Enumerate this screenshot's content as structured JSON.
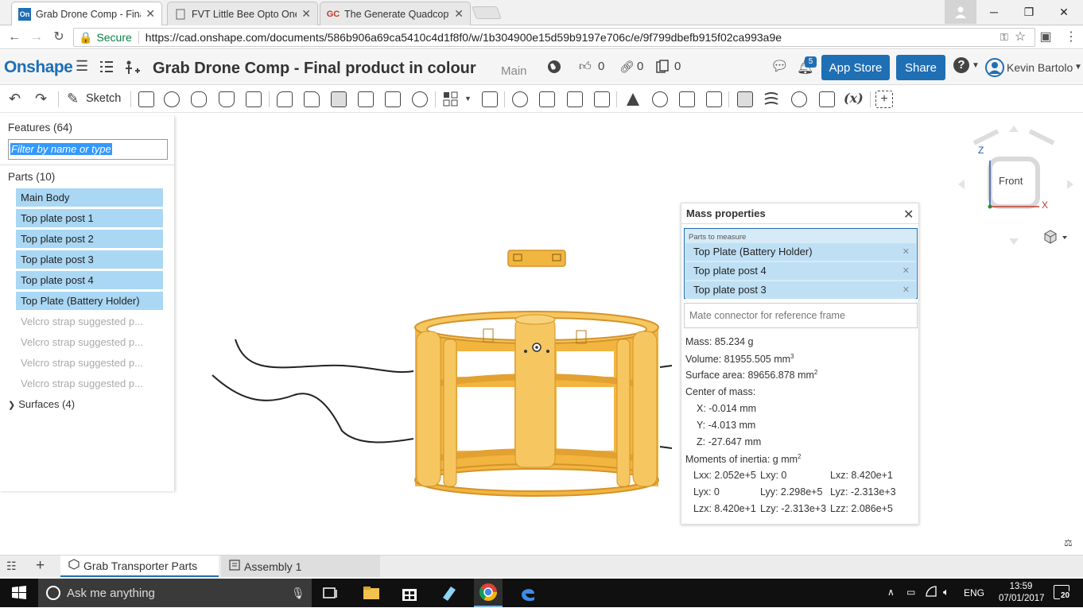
{
  "browser": {
    "tabs": [
      {
        "title": "Grab Drone Comp - Fina",
        "favicon": "On",
        "active": true
      },
      {
        "title": "FVT Little Bee Opto One",
        "favicon": "doc",
        "active": false
      },
      {
        "title": "The Generate Quadcopte",
        "favicon": "GC",
        "active": false
      }
    ],
    "secure_label": "Secure",
    "url": "https://cad.onshape.com/documents/586b906a69ca5410c4d1f8f0/w/1b304900e15d59b9197e706c/e/9f799dbefb915f02ca993a9e"
  },
  "header": {
    "logo": "Onshape",
    "doc_title": "Grab Drone Comp - Final product in colour",
    "branch": "Main",
    "likes": "0",
    "links": "0",
    "copies": "0",
    "notifications": "5",
    "app_store_label": "App Store",
    "share_label": "Share",
    "help_label": "?",
    "user": "Kevin Bartolo"
  },
  "toolbar": {
    "sketch_label": "Sketch",
    "variable_label": "(x)"
  },
  "features": {
    "title": "Features (64)",
    "filter_placeholder": "Filter by name or type",
    "parts_title": "Parts (10)",
    "parts": [
      {
        "name": "Main Body",
        "selected": true
      },
      {
        "name": "Top plate post 1",
        "selected": true
      },
      {
        "name": "Top plate post 2",
        "selected": true
      },
      {
        "name": "Top plate post 3",
        "selected": true
      },
      {
        "name": "Top plate post 4",
        "selected": true
      },
      {
        "name": "Top Plate (Battery Holder)",
        "selected": true
      },
      {
        "name": "Velcro strap suggested p...",
        "selected": false
      },
      {
        "name": "Velcro strap suggested p...",
        "selected": false
      },
      {
        "name": "Velcro strap suggested p...",
        "selected": false
      },
      {
        "name": "Velcro strap suggested p...",
        "selected": false
      }
    ],
    "surfaces": "Surfaces (4)"
  },
  "mass_properties": {
    "title": "Mass properties",
    "parts_label": "Parts to measure",
    "parts": [
      "Top Plate (Battery Holder)",
      "Top plate post 4",
      "Top plate post 3"
    ],
    "mate_placeholder": "Mate connector for reference frame",
    "mass": "Mass: 85.234 g",
    "volume": "Volume: 81955.505 mm",
    "volume_exp": "3",
    "surface_area": "Surface area: 89656.878 mm",
    "surface_exp": "2",
    "center_label": "Center of mass:",
    "cx": "X: -0.014 mm",
    "cy": "Y: -4.013 mm",
    "cz": "Z: -27.647 mm",
    "inertia_label": "Moments of inertia: g mm",
    "inertia_exp": "2",
    "inertia": [
      [
        "Lxx: 2.052e+5",
        "Lxy: 0",
        "Lxz: 8.420e+1"
      ],
      [
        "Lyx: 0",
        "Lyy: 2.298e+5",
        "Lyz: -2.313e+3"
      ],
      [
        "Lzx: 8.420e+1",
        "Lzy: -2.313e+3",
        "Lzz: 2.086e+5"
      ]
    ]
  },
  "viewcube": {
    "face": "Front",
    "z": "Z",
    "x": "X"
  },
  "bottom_tabs": [
    {
      "label": "Grab Transporter Parts",
      "active": true
    },
    {
      "label": "Assembly 1",
      "active": false
    }
  ],
  "taskbar": {
    "search": "Ask me anything",
    "lang": "ENG",
    "time": "13:59",
    "date": "07/01/2017",
    "notif_count": "20"
  },
  "colors": {
    "accent": "#1f6fb5",
    "part_yellow": "#f2b53f",
    "selection": "#a9d7f4"
  }
}
